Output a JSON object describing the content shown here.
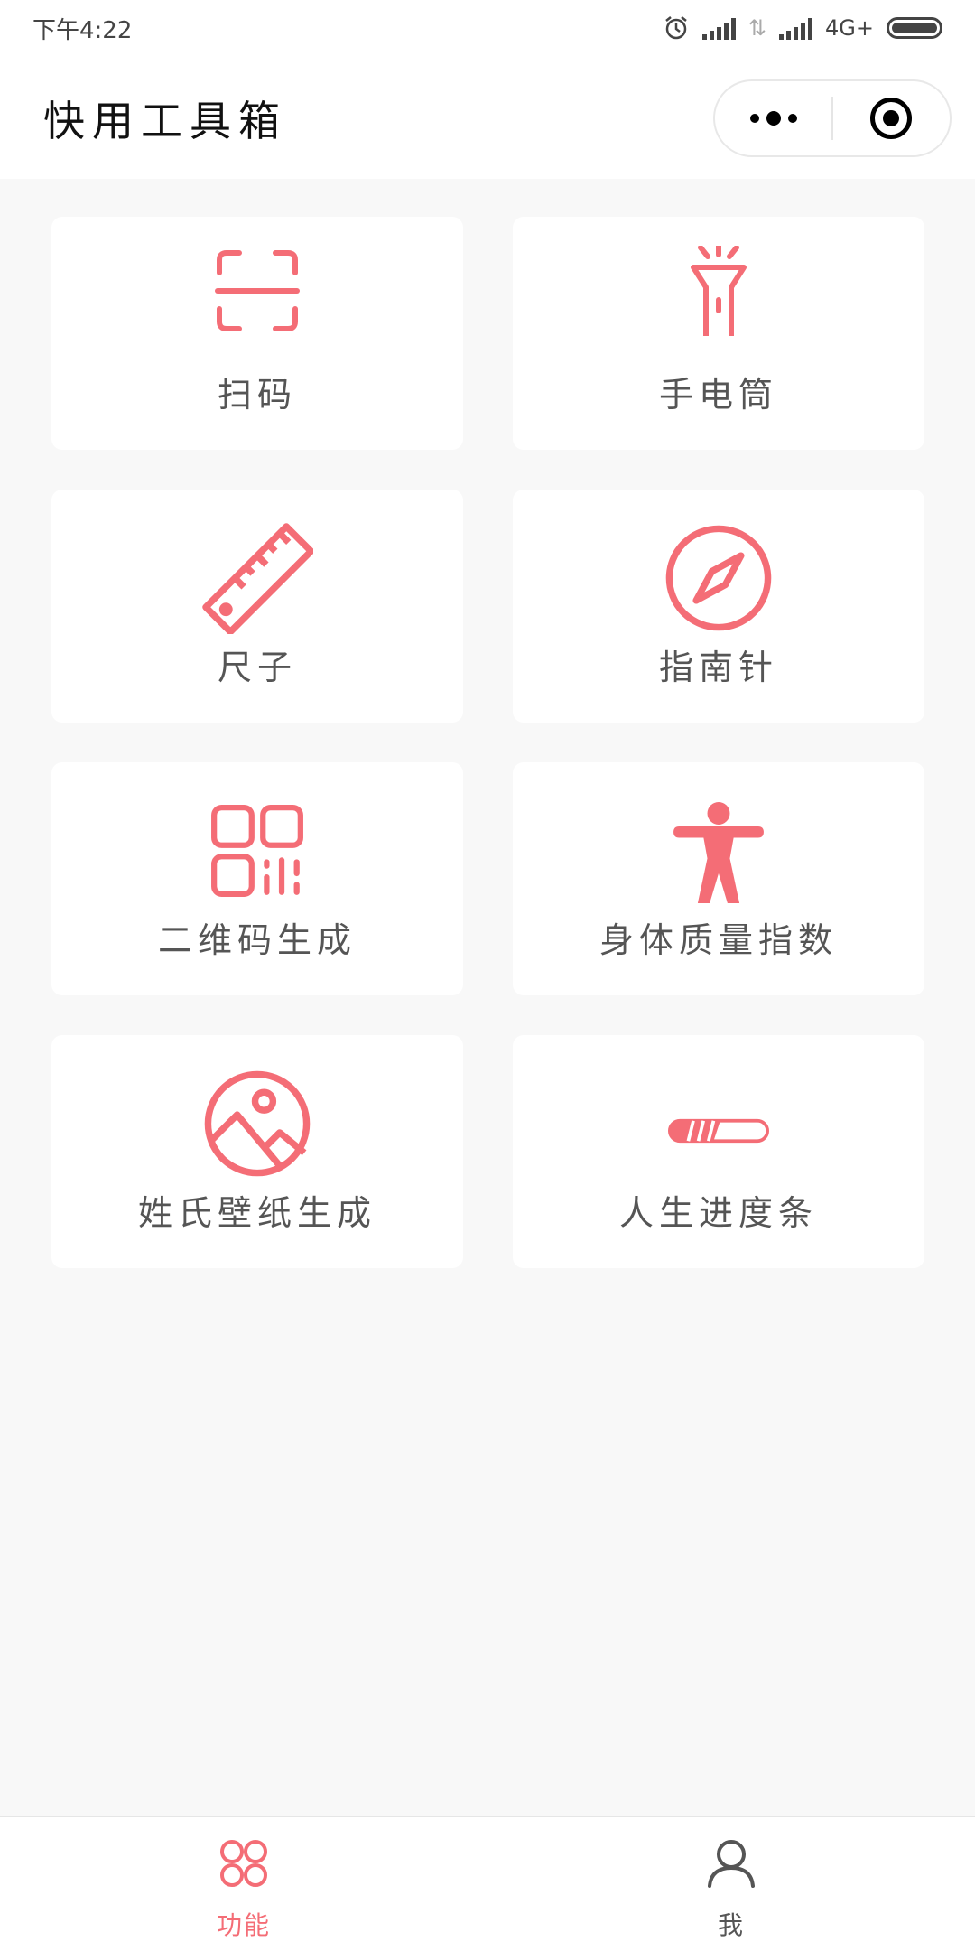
{
  "status_bar": {
    "time": "下午4:22",
    "network": "4G+",
    "icons": [
      "alarm-icon",
      "signal-icon",
      "data-arrows-icon",
      "signal-icon",
      "battery-icon"
    ]
  },
  "nav": {
    "title": "快用工具箱",
    "capsule": {
      "more_icon": "more-dots-icon",
      "close_icon": "target-icon"
    }
  },
  "accent_color": "#f46d76",
  "tools": [
    {
      "label": "扫码",
      "icon": "scan-icon"
    },
    {
      "label": "手电筒",
      "icon": "flashlight-icon"
    },
    {
      "label": "尺子",
      "icon": "ruler-icon"
    },
    {
      "label": "指南针",
      "icon": "compass-icon"
    },
    {
      "label": "二维码生成",
      "icon": "qrcode-icon"
    },
    {
      "label": "身体质量指数",
      "icon": "body-icon"
    },
    {
      "label": "姓氏壁纸生成",
      "icon": "image-icon"
    },
    {
      "label": "人生进度条",
      "icon": "progress-bar-icon"
    }
  ],
  "tab_bar": {
    "tabs": [
      {
        "label": "功能",
        "icon": "grid-icon",
        "active": true
      },
      {
        "label": "我",
        "icon": "user-icon",
        "active": false
      }
    ],
    "active_color": "#f46d76",
    "inactive_color": "#555555"
  }
}
